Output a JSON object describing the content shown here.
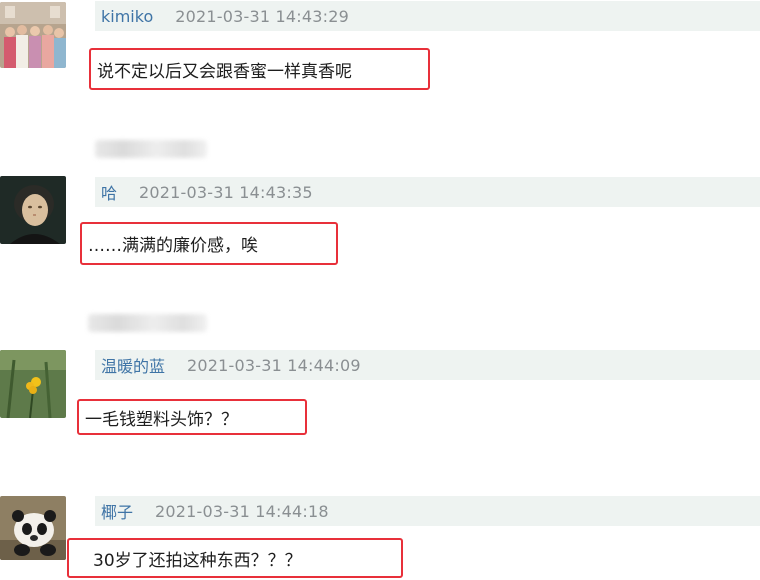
{
  "comments": [
    {
      "username": "kimiko",
      "timestamp": "2021-03-31 14:43:29",
      "text": "说不定以后又会跟香蜜一样真香呢",
      "avatar_icon": "group-photo-avatar-icon"
    },
    {
      "username": "哈",
      "timestamp": "2021-03-31 14:43:35",
      "text": "……满满的廉价感，唉",
      "avatar_icon": "portrait-painting-avatar-icon"
    },
    {
      "username": "温暖的蓝",
      "timestamp": "2021-03-31 14:44:09",
      "text": "一毛钱塑料头饰？？",
      "avatar_icon": "yellow-flower-avatar-icon"
    },
    {
      "username": "椰子",
      "timestamp": "2021-03-31 14:44:18",
      "text": "30岁了还拍这种东西？？？",
      "avatar_icon": "panda-avatar-icon"
    }
  ],
  "colors": {
    "highlight_border": "#e8303a",
    "meta_background": "#eef3f1",
    "username": "#3f74a6",
    "timestamp": "#8a8f92"
  }
}
